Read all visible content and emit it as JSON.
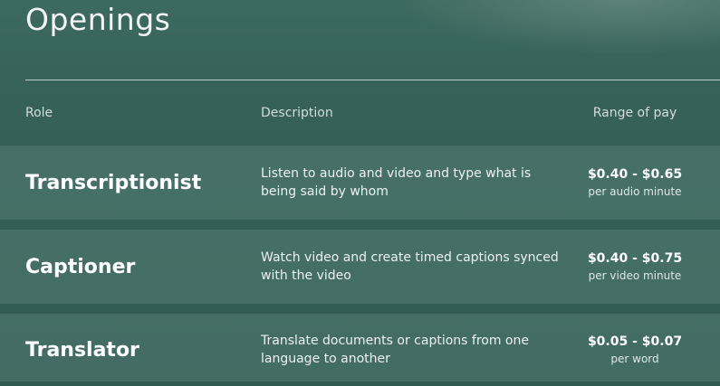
{
  "header": {
    "title": "Openings"
  },
  "table": {
    "columns": {
      "role": "Role",
      "description": "Description",
      "pay": "Range of pay"
    },
    "rows": [
      {
        "role": "Transcriptionist",
        "description": "Listen to audio and video and type what is being said by whom",
        "pay_range": "$0.40 - $0.65",
        "pay_unit": "per audio minute"
      },
      {
        "role": "Captioner",
        "description": "Watch video and create timed captions synced with the video",
        "pay_range": "$0.40 - $0.75",
        "pay_unit": "per video minute"
      },
      {
        "role": "Translator",
        "description": "Translate documents or captions from one language to another",
        "pay_range": "$0.05 - $0.07",
        "pay_unit": "per word"
      }
    ]
  }
}
